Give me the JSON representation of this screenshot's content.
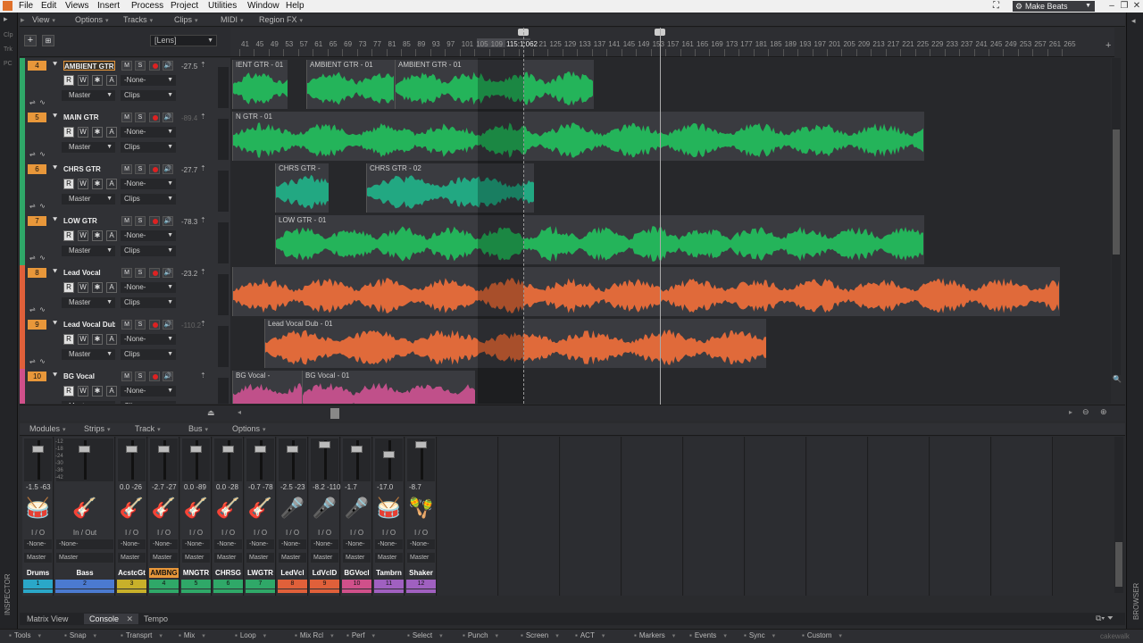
{
  "menubar": {
    "items": [
      "File",
      "Edit",
      "Views",
      "Insert",
      "Process",
      "Project",
      "Utilities",
      "Window",
      "Help"
    ],
    "workspace": "Make Beats"
  },
  "left_strip": {
    "labels": [
      "Clp",
      "Trk",
      "PC"
    ],
    "inspector": "INSPECTOR"
  },
  "right_strip": {
    "browser": "BROWSER"
  },
  "track_menu": {
    "items": [
      "View",
      "Options",
      "Tracks",
      "Clips",
      "MIDI",
      "Region FX"
    ]
  },
  "track_header": {
    "lens": "[Lens]",
    "add_icon": "plus-icon",
    "grid_icon": "grid-icon"
  },
  "ruler": {
    "ticks": [
      "41",
      "45",
      "49",
      "53",
      "57",
      "61",
      "65",
      "69",
      "73",
      "77",
      "81",
      "85",
      "89",
      "93",
      "97",
      "101",
      "105",
      "109",
      "113",
      "117",
      "121",
      "125",
      "129",
      "133",
      "137",
      "141",
      "145",
      "149",
      "153",
      "157",
      "161",
      "165",
      "169",
      "173",
      "177",
      "181",
      "185",
      "189",
      "193",
      "197",
      "201",
      "205",
      "209",
      "213",
      "217",
      "221",
      "225",
      "229",
      "233",
      "237",
      "241",
      "245",
      "249",
      "253",
      "257",
      "261",
      "265"
    ],
    "now_time": "115:1:062"
  },
  "tracks": [
    {
      "num": "4",
      "name": "AMBIENT GTR",
      "vol": "-27.5",
      "vol_dim": false,
      "input": "-None-",
      "output": "Master",
      "clips_mode": "Clips",
      "color": "#2fa868",
      "selected": true,
      "clips": [
        {
          "name": "IENT GTR - 01",
          "start": 0,
          "end": 62
        },
        {
          "name": "AMBIENT GTR - 01",
          "start": 83,
          "end": 182
        },
        {
          "name": "AMBIENT GTR - 01",
          "start": 182,
          "end": 405
        }
      ],
      "wave_color": "#24b45a"
    },
    {
      "num": "5",
      "name": "MAIN GTR",
      "vol": "-89.4",
      "vol_dim": true,
      "input": "-None-",
      "output": "Master",
      "clips_mode": "Clips",
      "color": "#2fa868",
      "selected": false,
      "clips": [
        {
          "name": "N GTR - 01",
          "start": 0,
          "end": 775
        }
      ],
      "wave_color": "#24b45a"
    },
    {
      "num": "6",
      "name": "CHRS GTR",
      "vol": "-27.7",
      "vol_dim": false,
      "input": "-None-",
      "output": "Master",
      "clips_mode": "Clips",
      "color": "#2fa868",
      "selected": false,
      "clips": [
        {
          "name": "CHRS GTR -",
          "start": 48,
          "end": 108
        },
        {
          "name": "CHRS GTR - 02",
          "start": 150,
          "end": 338
        }
      ],
      "wave_color": "#22a882"
    },
    {
      "num": "7",
      "name": "LOW GTR",
      "vol": "-78.3",
      "vol_dim": false,
      "input": "-None-",
      "output": "Master",
      "clips_mode": "Clips",
      "color": "#2fa868",
      "selected": false,
      "clips": [
        {
          "name": "LOW GTR - 01",
          "start": 48,
          "end": 775
        }
      ],
      "wave_color": "#24b45a"
    },
    {
      "num": "8",
      "name": "Lead Vocal",
      "vol": "-23.2",
      "vol_dim": false,
      "input": "-None-",
      "output": "Master",
      "clips_mode": "Clips",
      "color": "#e0603a",
      "selected": false,
      "clips": [
        {
          "name": "",
          "start": 0,
          "end": 927
        }
      ],
      "wave_color": "#e06a3a"
    },
    {
      "num": "9",
      "name": "Lead Vocal Dub",
      "vol": "-110.2",
      "vol_dim": true,
      "input": "-None-",
      "output": "Master",
      "clips_mode": "Clips",
      "color": "#e0603a",
      "selected": false,
      "clips": [
        {
          "name": "Lead Vocal Dub - 01",
          "start": 36,
          "end": 598
        }
      ],
      "wave_color": "#e06a3a"
    },
    {
      "num": "10",
      "name": "BG Vocal",
      "vol": "",
      "vol_dim": false,
      "input": "-None-",
      "output": "Master",
      "clips_mode": "Clips",
      "color": "#d0508a",
      "selected": false,
      "clips": [
        {
          "name": "BG Vocal -",
          "start": 0,
          "end": 78
        },
        {
          "name": "BG Vocal - 01",
          "start": 78,
          "end": 272
        }
      ],
      "wave_color": "#c0508a"
    }
  ],
  "console_menu": {
    "items": [
      "Modules",
      "Strips",
      "Track",
      "Bus",
      "Options"
    ]
  },
  "strips": [
    {
      "name": "Drums",
      "num": "1",
      "vol": "-1.5  -63",
      "io": "I / O",
      "input": "-None-",
      "output": "Master",
      "icon": "drums-icon",
      "glyph": "🥁",
      "color": "#2aa7c8",
      "fader": 0.15,
      "selected": false,
      "wide": false
    },
    {
      "name": "Bass",
      "num": "2",
      "vol": "",
      "io": "In / Out",
      "input": "-None-",
      "output": "Master",
      "icon": "bass-guitar-icon",
      "glyph": "🎸",
      "color": "#4b7ad0",
      "fader": 0.15,
      "selected": false,
      "wide": true
    },
    {
      "name": "AcstcGt",
      "num": "3",
      "vol": "0.0  -26",
      "io": "I / O",
      "input": "-None-",
      "output": "Master",
      "icon": "acoustic-guitar-icon",
      "glyph": "🎸",
      "color": "#c8b02a",
      "fader": 0.15,
      "selected": false,
      "wide": false
    },
    {
      "name": "AMBNG",
      "num": "4",
      "vol": "-2.7  -27",
      "io": "I / O",
      "input": "-None-",
      "output": "Master",
      "icon": "electric-guitar-icon",
      "glyph": "🎸",
      "color": "#2fa868",
      "fader": 0.15,
      "selected": true,
      "wide": false
    },
    {
      "name": "MNGTR",
      "num": "5",
      "vol": "0.0  -89",
      "io": "I / O",
      "input": "-None-",
      "output": "Master",
      "icon": "electric-guitar-icon",
      "glyph": "🎸",
      "color": "#2fa868",
      "fader": 0.15,
      "selected": false,
      "wide": false
    },
    {
      "name": "CHRSG",
      "num": "6",
      "vol": "0.0  -28",
      "io": "I / O",
      "input": "-None-",
      "output": "Master",
      "icon": "electric-guitar-icon",
      "glyph": "🎸",
      "color": "#2fa868",
      "fader": 0.15,
      "selected": false,
      "wide": false
    },
    {
      "name": "LWGTR",
      "num": "7",
      "vol": "-0.7  -78",
      "io": "I / O",
      "input": "-None-",
      "output": "Master",
      "icon": "electric-guitar-icon",
      "glyph": "🎸",
      "color": "#2fa868",
      "fader": 0.15,
      "selected": false,
      "wide": false
    },
    {
      "name": "LedVcl",
      "num": "8",
      "vol": "-2.5  -23",
      "io": "I / O",
      "input": "-None-",
      "output": "Master",
      "icon": "microphone-icon",
      "glyph": "🎤",
      "color": "#e0603a",
      "fader": 0.15,
      "selected": false,
      "wide": false
    },
    {
      "name": "LdVclD",
      "num": "9",
      "vol": "-8.2  -110",
      "io": "I / O",
      "input": "-None-",
      "output": "Master",
      "icon": "microphone-icon",
      "glyph": "🎤",
      "color": "#e0603a",
      "fader": 0.02,
      "selected": false,
      "wide": false
    },
    {
      "name": "BGVocl",
      "num": "10",
      "vol": "-1.7",
      "io": "I / O",
      "input": "-None-",
      "output": "Master",
      "icon": "microphone-icon",
      "glyph": "🎤",
      "color": "#d0508a",
      "fader": 0.15,
      "selected": false,
      "wide": false
    },
    {
      "name": "Tambrn",
      "num": "11",
      "vol": "-17.0",
      "io": "I / O",
      "input": "-None-",
      "output": "Master",
      "icon": "tambourine-icon",
      "glyph": "🥁",
      "color": "#a060c0",
      "fader": 0.3,
      "selected": false,
      "wide": false
    },
    {
      "name": "Shaker",
      "num": "12",
      "vol": "-8.7",
      "io": "I / O",
      "input": "-None-",
      "output": "Master",
      "icon": "shaker-icon",
      "glyph": "🪇",
      "color": "#a060c0",
      "fader": 0.02,
      "selected": false,
      "wide": false
    }
  ],
  "drums_meter_scale": [
    "-12",
    "-18",
    "-24",
    "-30",
    "-36",
    "-42"
  ],
  "bottom_tabs": [
    "Matrix View",
    "Console",
    "Tempo"
  ],
  "control_bar": [
    "Tools",
    "Snap",
    "Transprt",
    "Mix",
    "Loop",
    "Mix Rcl",
    "Perf",
    "Select",
    "Punch",
    "Screen",
    "ACT",
    "Markers",
    "Events",
    "Sync",
    "Custom"
  ],
  "watermark": "cakewalk"
}
